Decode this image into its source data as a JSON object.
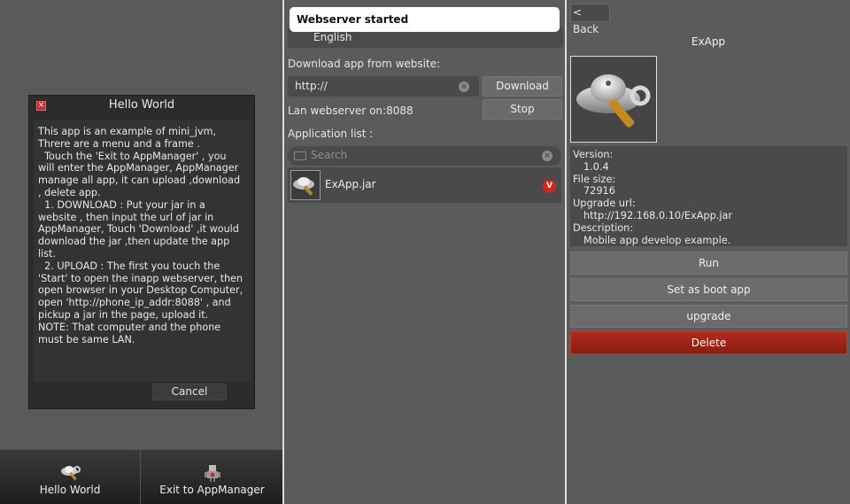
{
  "panel1": {
    "dialog": {
      "title": "Hello World",
      "body": "This app is an example of mini_jvm, Threre are a menu and a frame .\n  Touch the 'Exit to AppManager' , you will enter the AppManager, AppManager manage all app, it can upload ,download , delete app.\n  1. DOWNLOAD : Put your jar in a website , then input the url of jar in AppManager, Touch 'Download' ,it would download the jar ,then update the app list.\n  2. UPLOAD : The first you touch the 'Start' to open the inapp webserver, then open browser in your Desktop Computer, open 'http://phone_ip_addr:8088' , and pickup a jar in the page, upload it.\nNOTE: That computer and the phone must be same LAN.",
      "cancel_label": "Cancel"
    },
    "tabs": [
      {
        "label": "Hello World",
        "icon": "saucer-wrench-icon"
      },
      {
        "label": "Exit to AppManager",
        "icon": "robot-icon"
      }
    ]
  },
  "panel2": {
    "toast": "Webserver started",
    "language": "English",
    "download_label": "Download app from website:",
    "url_value": "http://",
    "download_button": "Download",
    "lan_label": "Lan webserver on:8088",
    "stop_button": "Stop",
    "app_list_label": "Application list :",
    "search_placeholder": "Search",
    "apps": [
      {
        "name": "ExApp.jar",
        "badge": "V"
      }
    ]
  },
  "panel3": {
    "back_label": "< Back",
    "title": "ExApp",
    "info": {
      "version_label": "Version:",
      "version": "1.0.4",
      "size_label": "File size:",
      "size": "72916",
      "url_label": "Upgrade url:",
      "url": "http://192.168.0.10/ExApp.jar",
      "desc_label": "Description:",
      "desc": "Mobile app develop example."
    },
    "actions": {
      "run": "Run",
      "boot": "Set as boot app",
      "upgrade": "upgrade",
      "delete": "Delete"
    }
  },
  "colors": {
    "delete": "#a0241a",
    "badge": "#d8231a",
    "toast_bg": "#ffffff"
  }
}
